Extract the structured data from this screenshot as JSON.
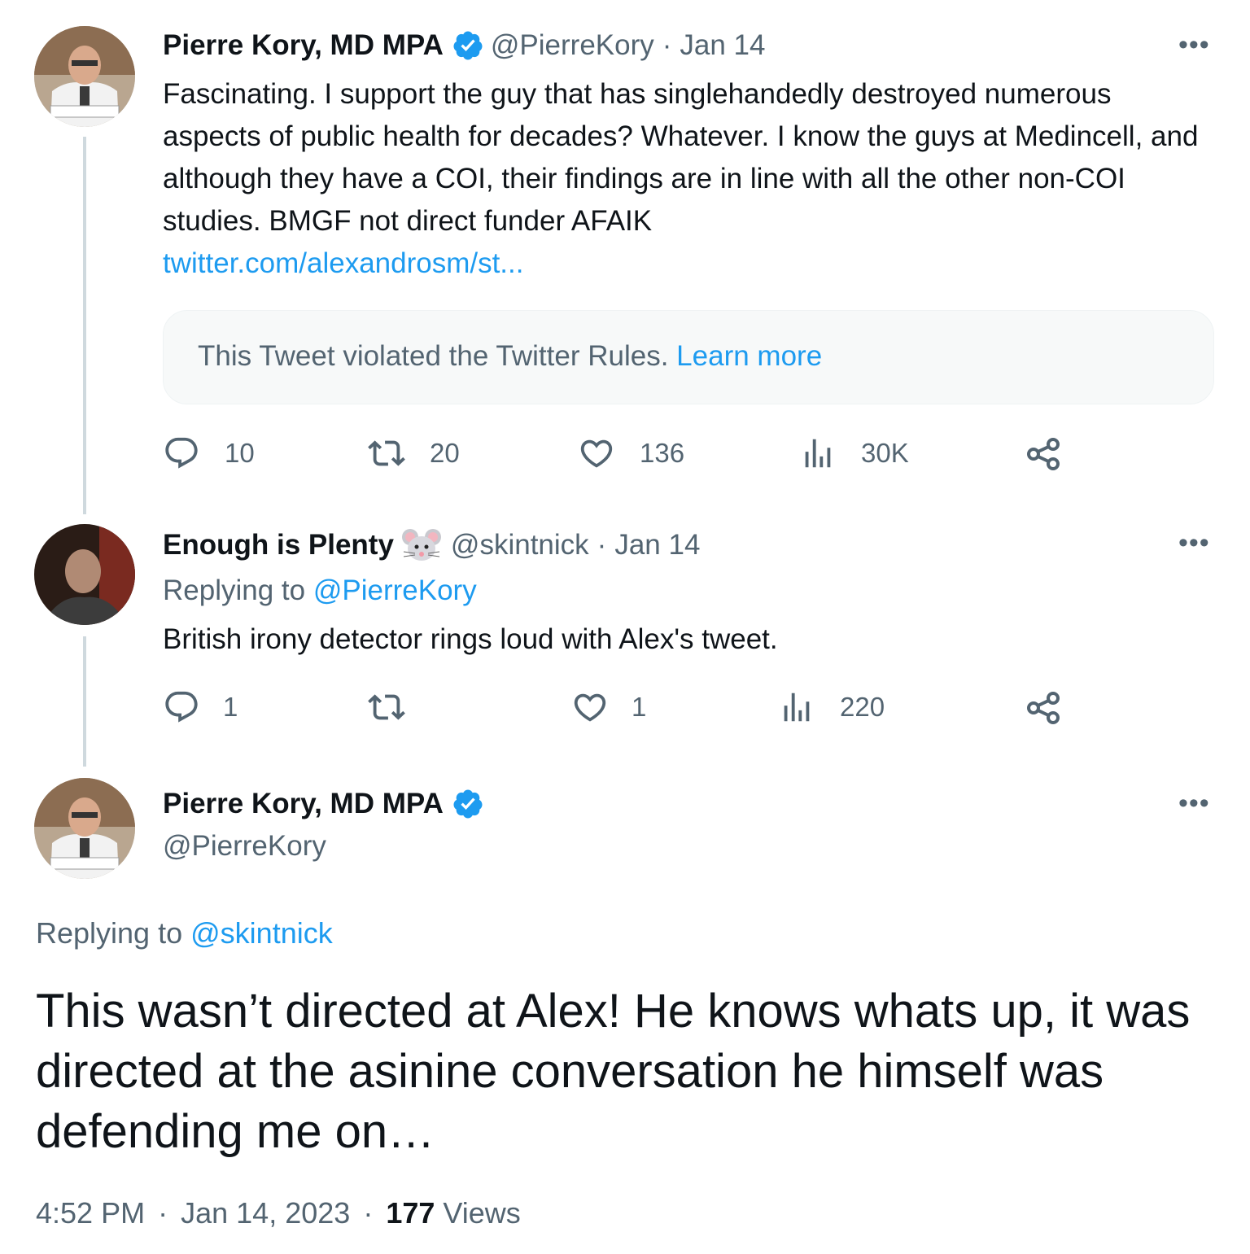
{
  "tweet1": {
    "name": "Pierre Kory, MD MPA",
    "handle": "@PierreKory",
    "date": "Jan 14",
    "text": "Fascinating. I support the guy that has singlehandedly destroyed numerous aspects of public health for decades? Whatever. I know the guys at Medincell, and although they have a COI, their findings are in line with all the other non-COI studies. BMGF not direct funder AFAIK",
    "link": "twitter.com/alexandrosm/st...",
    "notice_text": "This Tweet violated the Twitter Rules.",
    "notice_link": "Learn more",
    "replies": "10",
    "retweets": "20",
    "likes": "136",
    "views": "30K"
  },
  "tweet2": {
    "name": "Enough is Plenty",
    "handle": "@skintnick",
    "date": "Jan 14",
    "replying_label": "Replying to",
    "replying_handle": "@PierreKory",
    "text": "British irony detector rings loud with Alex's tweet.",
    "replies": "1",
    "retweets": "",
    "likes": "1",
    "views": "220"
  },
  "tweet3": {
    "name": "Pierre Kory, MD MPA",
    "handle": "@PierreKory",
    "replying_label": "Replying to",
    "replying_handle": "@skintnick",
    "text": "This wasn’t directed at Alex! He knows whats up, it was directed at the asinine conversation he himself was defending me on…",
    "time": "4:52 PM",
    "date": "Jan 14, 2023",
    "views_count": "177",
    "views_label": "Views"
  },
  "separator": "·",
  "more_label": "•••",
  "icons": [
    "reply-icon",
    "retweet-icon",
    "like-icon",
    "views-icon",
    "share-icon",
    "verified-icon",
    "mouse-emoji-icon",
    "more-icon"
  ],
  "colors": {
    "link": "#1d9bf0",
    "secondary": "#536471",
    "text": "#0f1419",
    "thread_line": "#cfd9de"
  }
}
